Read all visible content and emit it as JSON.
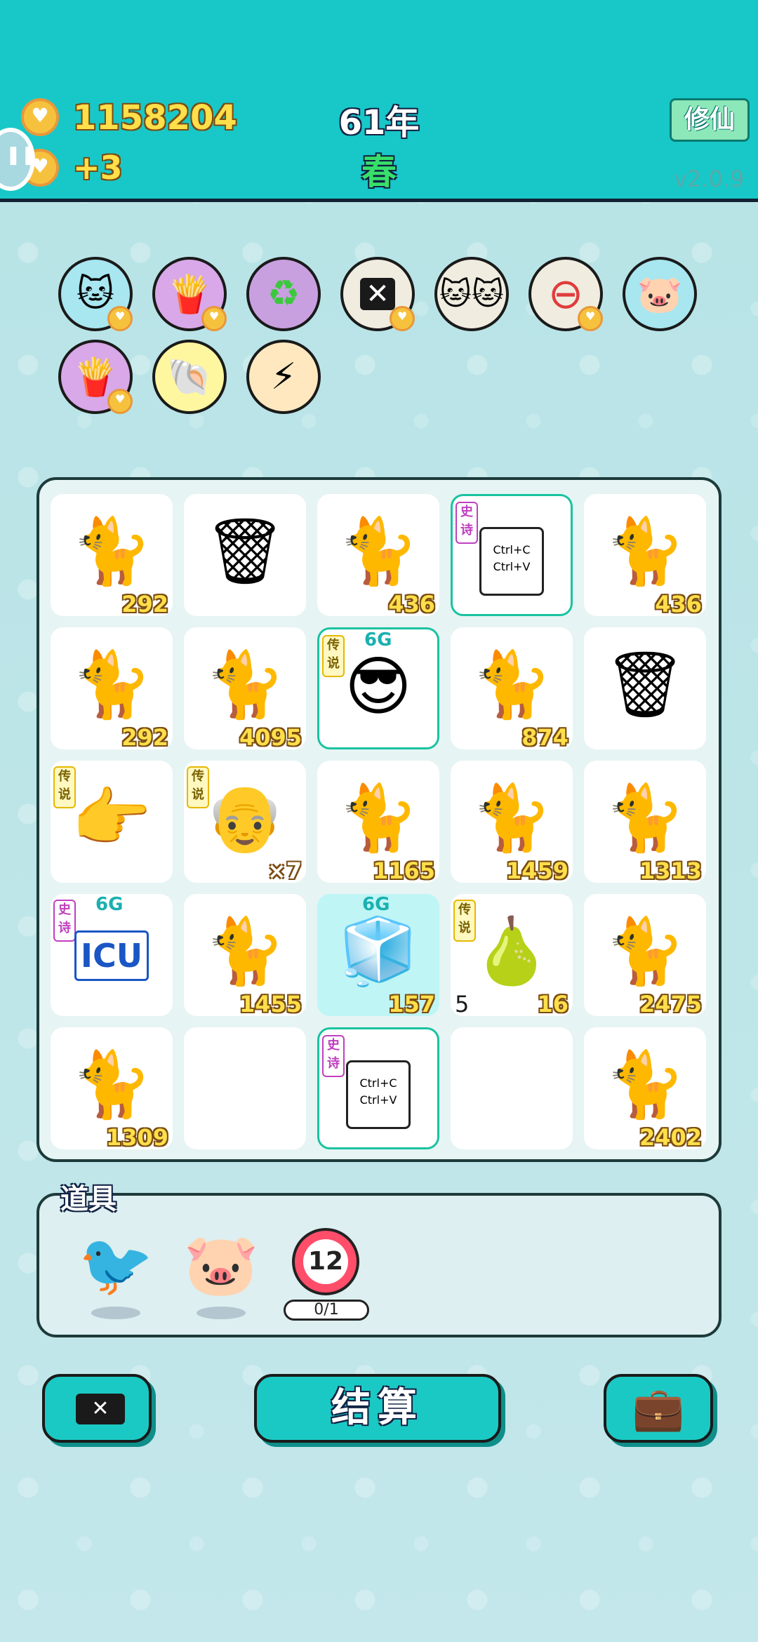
{
  "header": {
    "money": "1158204",
    "income": "+3",
    "year": "61年",
    "season": "春",
    "mode_button": "修仙",
    "version": "v2.0.9"
  },
  "buffs": [
    "cat-buff-icon",
    "fries-icon",
    "recycle-icon",
    "delete-tag-icon",
    "two-cats-icon",
    "minus-icon",
    "piggy-bank-icon",
    "fries-icon",
    "shell-icon",
    "lightning-icon"
  ],
  "board": {
    "cells": [
      {
        "kind": "cat",
        "num": "292"
      },
      {
        "kind": "trash"
      },
      {
        "kind": "cat",
        "num": "436"
      },
      {
        "kind": "copy",
        "tag": "史诗"
      },
      {
        "kind": "cat",
        "num": "436"
      },
      {
        "kind": "cat",
        "num": "292"
      },
      {
        "kind": "cat",
        "num": "4095"
      },
      {
        "kind": "man",
        "tag": "传说",
        "sixg": "6G"
      },
      {
        "kind": "cat",
        "num": "874"
      },
      {
        "kind": "trash"
      },
      {
        "kind": "hand",
        "tag": "传说"
      },
      {
        "kind": "grandpa",
        "tag": "传说",
        "num": "×7"
      },
      {
        "kind": "cat",
        "num": "1165"
      },
      {
        "kind": "cat",
        "num": "1459"
      },
      {
        "kind": "cat",
        "num": "1313"
      },
      {
        "kind": "icu",
        "tag": "史诗",
        "sixg": "6G",
        "icu": "ICU"
      },
      {
        "kind": "cat",
        "num": "1455"
      },
      {
        "kind": "fridge",
        "sixg": "6G",
        "num": "157"
      },
      {
        "kind": "gourd",
        "tag": "传说",
        "num": "16",
        "lnum": "5"
      },
      {
        "kind": "cat",
        "num": "2475"
      },
      {
        "kind": "cat",
        "num": "1309"
      },
      {
        "kind": "empty"
      },
      {
        "kind": "copy",
        "tag": "史诗"
      },
      {
        "kind": "empty"
      },
      {
        "kind": "cat",
        "num": "2402"
      }
    ],
    "copy_text": "Ctrl+C Ctrl+V"
  },
  "items": {
    "title": "道具",
    "timer": "12",
    "progress": "0/1"
  },
  "buttons": {
    "settle": "结算"
  },
  "colors": {
    "header": "#18c8c8",
    "accent": "#1bc9c4",
    "number": "#ffdf4a"
  }
}
